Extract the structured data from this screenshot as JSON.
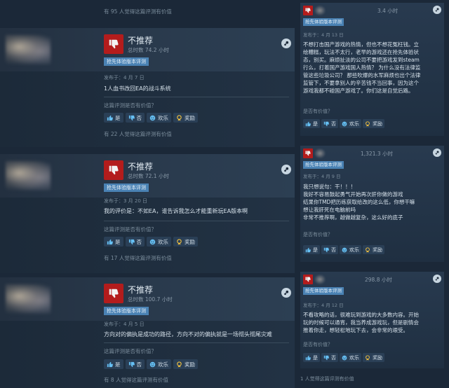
{
  "left": {
    "top_helpful": "有 95 人觉得这篇评测有价值",
    "reviews": [
      {
        "verdict": "不推荐",
        "hours": "总时数 74.2 小时",
        "badge": "抢先体验版本评测",
        "posted": "发布于：4 月 7 日",
        "content": "1人血书改回EA的战斗系统",
        "question": "这篇评测是否有价值？",
        "yes": "是",
        "no": "否",
        "funny": "欢乐",
        "award": "奖励",
        "helpful": "有 22 人觉得这篇评测有价值"
      },
      {
        "verdict": "不推荐",
        "hours": "总时数 72.1 小时",
        "badge": "抢先体验版本评测",
        "posted": "发布于：3 月 20 日",
        "content": "我的评价是：不如EA，谁告诉我怎么才能重新玩EA版本啊",
        "question": "这篇评测是否有价值？",
        "yes": "是",
        "no": "否",
        "funny": "欢乐",
        "award": "奖励",
        "helpful": "有 17 人觉得这篇评测有价值"
      },
      {
        "verdict": "不推荐",
        "hours": "总时数 100.7 小时",
        "badge": "抢先体验版本评测",
        "posted": "发布于：4 月 5 日",
        "content": "方向对的偏执是成功的路径，方向不对的偏执就是一场彻头彻尾灾难",
        "question": "这篇评测是否有价值？",
        "yes": "是",
        "no": "否",
        "funny": "欢乐",
        "award": "奖励",
        "helpful": "有 8 人觉得这篇评测有价值"
      }
    ]
  },
  "right": {
    "cards": [
      {
        "hours": "3.4 小时",
        "badge": "抢先体验版本评测",
        "posted": "发布于：4 月 13 日",
        "lines": [
          "不想打击国产游戏的热情，但也不想花冤枉钱。立",
          "绘糟糕，玩法不太行，老早的游戏还在抢先体验状",
          "态，别买。麻烦扯淡的公司不要把游戏发到steam",
          "行么，打着国产游戏国人热情？ 为什么没有法律监",
          "管这些垃圾公司？ 那些吹爆的水军麻烦也出个法律",
          "监管下，不要拿别人的辛苦钱不当回事，因为这个",
          "游戏我都不碰国产游戏了。你们这是自觉后路。"
        ],
        "question": "是否有价值？",
        "yes": "是",
        "no": "否",
        "funny": "欢乐",
        "award": "奖励"
      },
      {
        "hours": "1,321.3 小时",
        "badge": "抢先体验版本评测",
        "posted": "发布于：4 月 9 日",
        "lines": [
          "我只想说句：干！！！",
          "我好不容易鼓起勇气开始再次肝你做的游戏",
          "结果你TMD把历练获取给改的这么低，你想干嘛",
          "想让我肝死在电脑前吗",
          "非常不推荐啊，越做越复杂，这么好的底子"
        ],
        "question": "是否有价值？",
        "yes": "是",
        "no": "否",
        "funny": "欢乐",
        "award": "奖励"
      },
      {
        "hours": "298.8 小时",
        "badge": "抢先体验版本评测",
        "posted": "发布于：4 月 12 日",
        "lines": [
          "不看攻略的话，很难玩到游戏的大多数内容。开始",
          "玩的时候可以通宵，我当养成游戏玩，但是剧情会",
          "推着你走，想轻松地玩下去，会非常的艰受。"
        ],
        "question": "是否有价值？",
        "yes": "是",
        "no": "否",
        "funny": "欢乐",
        "award": "奖励"
      }
    ],
    "bottom_helpful": "1 人觉得这篇评测有价值"
  },
  "colors": {
    "background": "#1b2838",
    "thumb_down": "#b31c1c",
    "badge": "#4a82b4"
  }
}
